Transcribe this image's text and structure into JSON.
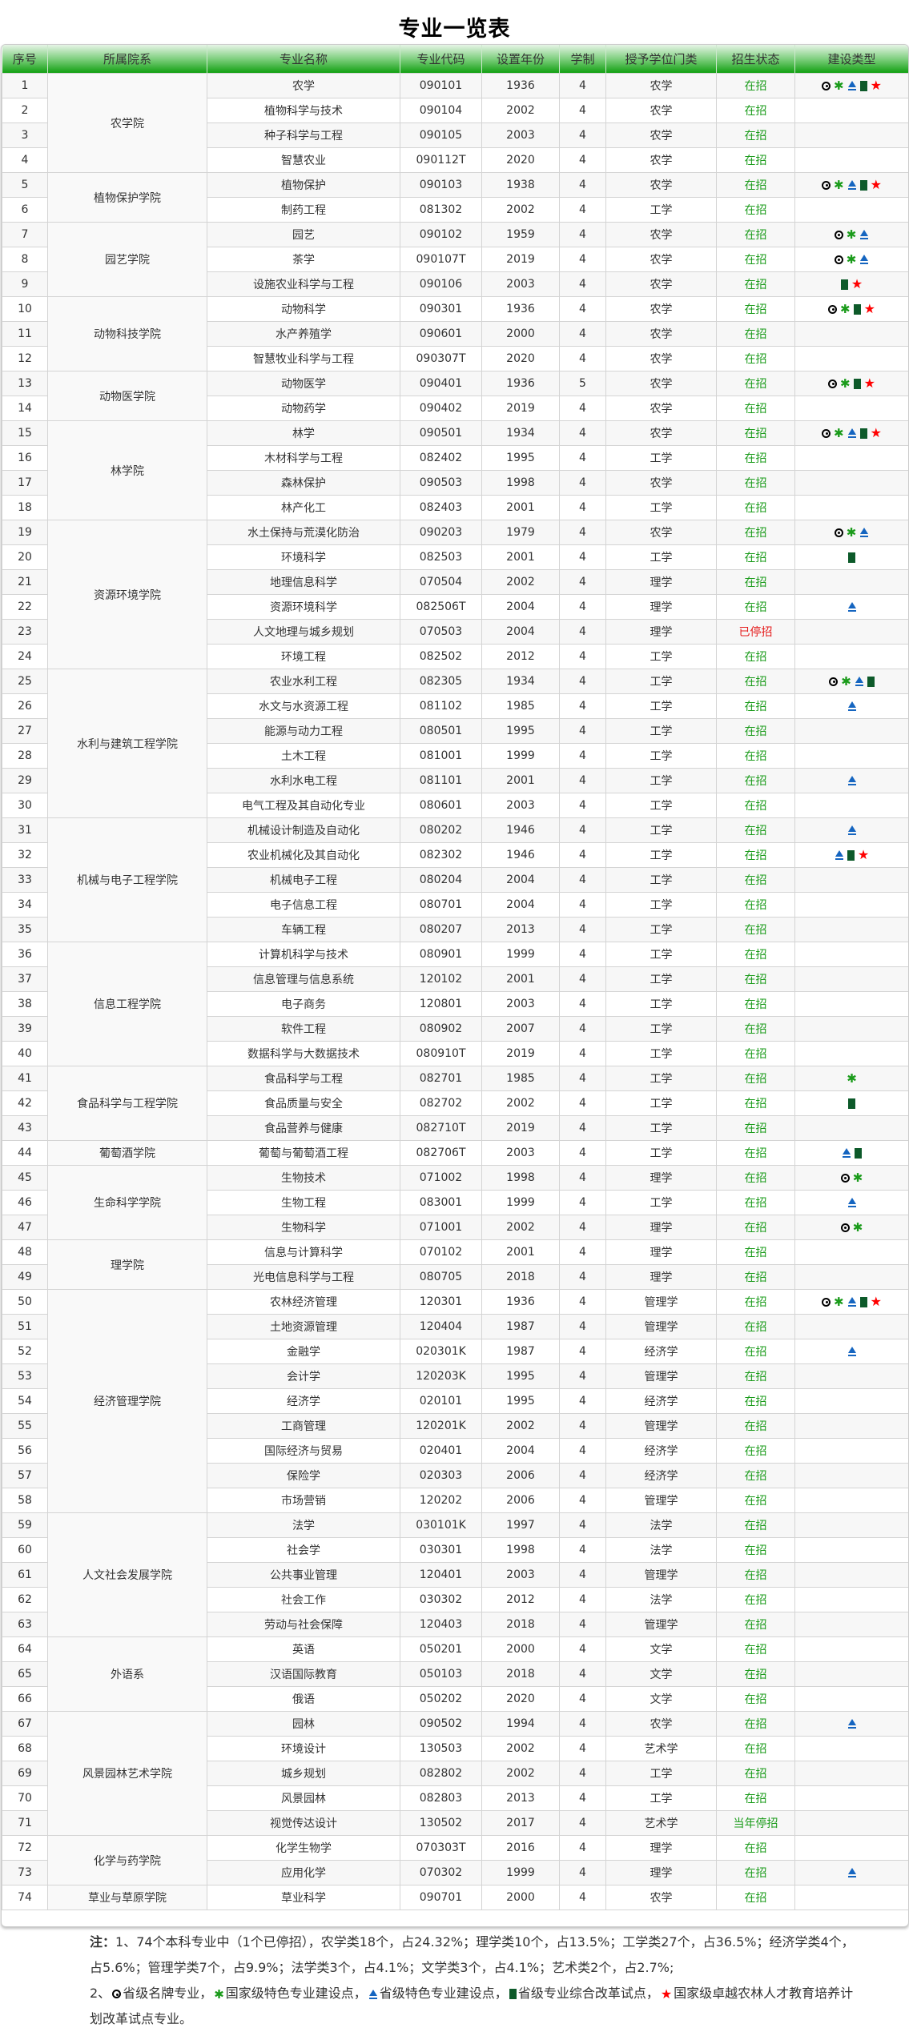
{
  "title": "专业一览表",
  "columns": [
    "序号",
    "所属院系",
    "专业名称",
    "专业代码",
    "设置年份",
    "学制",
    "授予学位门类",
    "招生状态",
    "建设类型"
  ],
  "colors": {
    "active": "#1a9b1a",
    "stopped": "#e51c1c",
    "header_green": "#12a012"
  },
  "icon_legend": {
    "o": "circle-dot-icon",
    "g": "green-asterisk-icon",
    "b": "blue-triangle-icon",
    "d": "dark-green-square-icon",
    "r": "red-star-icon"
  },
  "groups": [
    {
      "name": "农学院",
      "rows": 4
    },
    {
      "name": "植物保护学院",
      "rows": 2
    },
    {
      "name": "园艺学院",
      "rows": 3
    },
    {
      "name": "动物科技学院",
      "rows": 3
    },
    {
      "name": "动物医学院",
      "rows": 2
    },
    {
      "name": "林学院",
      "rows": 4
    },
    {
      "name": "资源环境学院",
      "rows": 6
    },
    {
      "name": "水利与建筑工程学院",
      "rows": 6
    },
    {
      "name": "机械与电子工程学院",
      "rows": 5
    },
    {
      "name": "信息工程学院",
      "rows": 5
    },
    {
      "name": "食品科学与工程学院",
      "rows": 3
    },
    {
      "name": "葡萄酒学院",
      "rows": 1
    },
    {
      "name": "生命科学学院",
      "rows": 3
    },
    {
      "name": "理学院",
      "rows": 2
    },
    {
      "name": "经济管理学院",
      "rows": 9
    },
    {
      "name": "人文社会发展学院",
      "rows": 5
    },
    {
      "name": "外语系",
      "rows": 3
    },
    {
      "name": "风景园林艺术学院",
      "rows": 5
    },
    {
      "name": "化学与药学院",
      "rows": 2
    },
    {
      "name": "草业与草原学院",
      "rows": 1
    }
  ],
  "rows": [
    [
      "1",
      "农学",
      "090101",
      "1936",
      "4",
      "农学",
      "在招",
      "ogbdr"
    ],
    [
      "2",
      "植物科学与技术",
      "090104",
      "2002",
      "4",
      "农学",
      "在招",
      ""
    ],
    [
      "3",
      "种子科学与工程",
      "090105",
      "2003",
      "4",
      "农学",
      "在招",
      ""
    ],
    [
      "4",
      "智慧农业",
      "090112T",
      "2020",
      "4",
      "农学",
      "在招",
      ""
    ],
    [
      "5",
      "植物保护",
      "090103",
      "1938",
      "4",
      "农学",
      "在招",
      "ogbdr"
    ],
    [
      "6",
      "制药工程",
      "081302",
      "2002",
      "4",
      "工学",
      "在招",
      ""
    ],
    [
      "7",
      "园艺",
      "090102",
      "1959",
      "4",
      "农学",
      "在招",
      "ogb"
    ],
    [
      "8",
      "茶学",
      "090107T",
      "2019",
      "4",
      "农学",
      "在招",
      "ogb"
    ],
    [
      "9",
      "设施农业科学与工程",
      "090106",
      "2003",
      "4",
      "农学",
      "在招",
      "dr"
    ],
    [
      "10",
      "动物科学",
      "090301",
      "1936",
      "4",
      "农学",
      "在招",
      "ogdr"
    ],
    [
      "11",
      "水产养殖学",
      "090601",
      "2000",
      "4",
      "农学",
      "在招",
      ""
    ],
    [
      "12",
      "智慧牧业科学与工程",
      "090307T",
      "2020",
      "4",
      "农学",
      "在招",
      ""
    ],
    [
      "13",
      "动物医学",
      "090401",
      "1936",
      "5",
      "农学",
      "在招",
      "ogdr"
    ],
    [
      "14",
      "动物药学",
      "090402",
      "2019",
      "4",
      "农学",
      "在招",
      ""
    ],
    [
      "15",
      "林学",
      "090501",
      "1934",
      "4",
      "农学",
      "在招",
      "ogbdr"
    ],
    [
      "16",
      "木材科学与工程",
      "082402",
      "1995",
      "4",
      "工学",
      "在招",
      ""
    ],
    [
      "17",
      "森林保护",
      "090503",
      "1998",
      "4",
      "农学",
      "在招",
      ""
    ],
    [
      "18",
      "林产化工",
      "082403",
      "2001",
      "4",
      "工学",
      "在招",
      ""
    ],
    [
      "19",
      "水土保持与荒漠化防治",
      "090203",
      "1979",
      "4",
      "农学",
      "在招",
      "ogb"
    ],
    [
      "20",
      "环境科学",
      "082503",
      "2001",
      "4",
      "工学",
      "在招",
      "d"
    ],
    [
      "21",
      "地理信息科学",
      "070504",
      "2002",
      "4",
      "理学",
      "在招",
      ""
    ],
    [
      "22",
      "资源环境科学",
      "082506T",
      "2004",
      "4",
      "理学",
      "在招",
      "b"
    ],
    [
      "23",
      "人文地理与城乡规划",
      "070503",
      "2004",
      "4",
      "理学",
      "已停招",
      ""
    ],
    [
      "24",
      "环境工程",
      "082502",
      "2012",
      "4",
      "工学",
      "在招",
      ""
    ],
    [
      "25",
      "农业水利工程",
      "082305",
      "1934",
      "4",
      "工学",
      "在招",
      "ogbd"
    ],
    [
      "26",
      "水文与水资源工程",
      "081102",
      "1985",
      "4",
      "工学",
      "在招",
      "b"
    ],
    [
      "27",
      "能源与动力工程",
      "080501",
      "1995",
      "4",
      "工学",
      "在招",
      ""
    ],
    [
      "28",
      "土木工程",
      "081001",
      "1999",
      "4",
      "工学",
      "在招",
      ""
    ],
    [
      "29",
      "水利水电工程",
      "081101",
      "2001",
      "4",
      "工学",
      "在招",
      "b"
    ],
    [
      "30",
      "电气工程及其自动化专业",
      "080601",
      "2003",
      "4",
      "工学",
      "在招",
      ""
    ],
    [
      "31",
      "机械设计制造及自动化",
      "080202",
      "1946",
      "4",
      "工学",
      "在招",
      "b"
    ],
    [
      "32",
      "农业机械化及其自动化",
      "082302",
      "1946",
      "4",
      "工学",
      "在招",
      "bdr"
    ],
    [
      "33",
      "机械电子工程",
      "080204",
      "2004",
      "4",
      "工学",
      "在招",
      ""
    ],
    [
      "34",
      "电子信息工程",
      "080701",
      "2004",
      "4",
      "工学",
      "在招",
      ""
    ],
    [
      "35",
      "车辆工程",
      "080207",
      "2013",
      "4",
      "工学",
      "在招",
      ""
    ],
    [
      "36",
      "计算机科学与技术",
      "080901",
      "1999",
      "4",
      "工学",
      "在招",
      ""
    ],
    [
      "37",
      "信息管理与信息系统",
      "120102",
      "2001",
      "4",
      "工学",
      "在招",
      ""
    ],
    [
      "38",
      "电子商务",
      "120801",
      "2003",
      "4",
      "工学",
      "在招",
      ""
    ],
    [
      "39",
      "软件工程",
      "080902",
      "2007",
      "4",
      "工学",
      "在招",
      ""
    ],
    [
      "40",
      "数据科学与大数据技术",
      "080910T",
      "2019",
      "4",
      "工学",
      "在招",
      ""
    ],
    [
      "41",
      "食品科学与工程",
      "082701",
      "1985",
      "4",
      "工学",
      "在招",
      "g"
    ],
    [
      "42",
      "食品质量与安全",
      "082702",
      "2002",
      "4",
      "工学",
      "在招",
      "d"
    ],
    [
      "43",
      "食品营养与健康",
      "082710T",
      "2019",
      "4",
      "工学",
      "在招",
      ""
    ],
    [
      "44",
      "葡萄与葡萄酒工程",
      "082706T",
      "2003",
      "4",
      "工学",
      "在招",
      "bd"
    ],
    [
      "45",
      "生物技术",
      "071002",
      "1998",
      "4",
      "理学",
      "在招",
      "og"
    ],
    [
      "46",
      "生物工程",
      "083001",
      "1999",
      "4",
      "工学",
      "在招",
      "b"
    ],
    [
      "47",
      "生物科学",
      "071001",
      "2002",
      "4",
      "理学",
      "在招",
      "og"
    ],
    [
      "48",
      "信息与计算科学",
      "070102",
      "2001",
      "4",
      "理学",
      "在招",
      ""
    ],
    [
      "49",
      "光电信息科学与工程",
      "080705",
      "2018",
      "4",
      "理学",
      "在招",
      ""
    ],
    [
      "50",
      "农林经济管理",
      "120301",
      "1936",
      "4",
      "管理学",
      "在招",
      "ogbdr"
    ],
    [
      "51",
      "土地资源管理",
      "120404",
      "1987",
      "4",
      "管理学",
      "在招",
      ""
    ],
    [
      "52",
      "金融学",
      "020301K",
      "1987",
      "4",
      "经济学",
      "在招",
      "b"
    ],
    [
      "53",
      "会计学",
      "120203K",
      "1995",
      "4",
      "管理学",
      "在招",
      ""
    ],
    [
      "54",
      "经济学",
      "020101",
      "1995",
      "4",
      "经济学",
      "在招",
      ""
    ],
    [
      "55",
      "工商管理",
      "120201K",
      "2002",
      "4",
      "管理学",
      "在招",
      ""
    ],
    [
      "56",
      "国际经济与贸易",
      "020401",
      "2004",
      "4",
      "经济学",
      "在招",
      ""
    ],
    [
      "57",
      "保险学",
      "020303",
      "2006",
      "4",
      "经济学",
      "在招",
      ""
    ],
    [
      "58",
      "市场营销",
      "120202",
      "2006",
      "4",
      "管理学",
      "在招",
      ""
    ],
    [
      "59",
      "法学",
      "030101K",
      "1997",
      "4",
      "法学",
      "在招",
      ""
    ],
    [
      "60",
      "社会学",
      "030301",
      "1998",
      "4",
      "法学",
      "在招",
      ""
    ],
    [
      "61",
      "公共事业管理",
      "120401",
      "2003",
      "4",
      "管理学",
      "在招",
      ""
    ],
    [
      "62",
      "社会工作",
      "030302",
      "2012",
      "4",
      "法学",
      "在招",
      ""
    ],
    [
      "63",
      "劳动与社会保障",
      "120403",
      "2018",
      "4",
      "管理学",
      "在招",
      ""
    ],
    [
      "64",
      "英语",
      "050201",
      "2000",
      "4",
      "文学",
      "在招",
      ""
    ],
    [
      "65",
      "汉语国际教育",
      "050103",
      "2018",
      "4",
      "文学",
      "在招",
      ""
    ],
    [
      "66",
      "俄语",
      "050202",
      "2020",
      "4",
      "文学",
      "在招",
      ""
    ],
    [
      "67",
      "园林",
      "090502",
      "1994",
      "4",
      "农学",
      "在招",
      "b"
    ],
    [
      "68",
      "环境设计",
      "130503",
      "2002",
      "4",
      "艺术学",
      "在招",
      ""
    ],
    [
      "69",
      "城乡规划",
      "082802",
      "2002",
      "4",
      "工学",
      "在招",
      ""
    ],
    [
      "70",
      "风景园林",
      "082803",
      "2013",
      "4",
      "工学",
      "在招",
      ""
    ],
    [
      "71",
      "视觉传达设计",
      "130502",
      "2017",
      "4",
      "艺术学",
      "当年停招",
      ""
    ],
    [
      "72",
      "化学生物学",
      "070303T",
      "2016",
      "4",
      "理学",
      "在招",
      ""
    ],
    [
      "73",
      "应用化学",
      "070302",
      "1999",
      "4",
      "理学",
      "在招",
      "b"
    ],
    [
      "74",
      "草业科学",
      "090701",
      "2000",
      "4",
      "农学",
      "在招",
      ""
    ]
  ],
  "notes": {
    "label": "注：",
    "line1": "1、74个本科专业中（1个已停招），农学类18个，占24.32%；理学类10个，占13.5%；工学类27个，占36.5%；经济学类4个，占5.6%；管理学类7个，占9.9%；法学类3个，占4.1%；文学类3个，占4.1%；艺术类2个，占2.7%;",
    "line2_prefix": "2、",
    "legend": [
      "省级名牌专业，",
      "国家级特色专业建设点，",
      "省级特色专业建设点，",
      "省级专业综合改革试点，",
      "国家级卓越农林人才教育培养计划改革试点专业。"
    ]
  }
}
